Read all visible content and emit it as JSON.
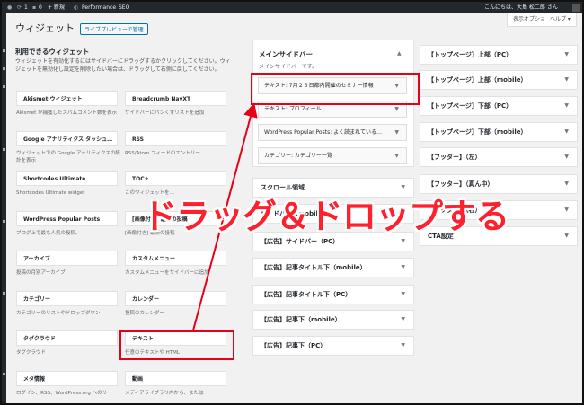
{
  "admin_bar": {
    "updates_count": "1",
    "comments_count": "0",
    "new_label": "+ 新規",
    "performance_label": "Performance",
    "seo_label": "SEO",
    "greeting": "こんにちは、大島 松二郎 さん"
  },
  "header": {
    "title": "ウィジェット",
    "preview_button": "ライブプレビューで管理",
    "screen_options": "表示オプション ▾",
    "help": "ヘルプ ▾"
  },
  "available": {
    "title": "利用できるウィジェット",
    "description": "ウィジェットを有効化するにはサイドバーにドラッグするかクリックしてください。ウィジェットを無効化し設定を削除したい場合は、ドラッグして右側に戻してください。",
    "widgets": [
      {
        "name": "Akismet ウィジェット",
        "desc": "Akismet が捕獲したスパムコメント数を表示"
      },
      {
        "name": "Breadcrumb NavXT",
        "desc": "サイドバーにパンくずリストを追加"
      },
      {
        "name": "Google アナリティクス タッシュ…",
        "desc": "ウィジェットでの Google アナリティクスの統計を表示"
      },
      {
        "name": "RSS",
        "desc": "RSS/Atom フィードのエントリー"
      },
      {
        "name": "Shortcodes Ultimate",
        "desc": "Shortcodes Ultimate widget"
      },
      {
        "name": "TOC+",
        "desc": "このウィジェットを…"
      },
      {
        "name": "WordPress Popular Posts",
        "desc": "ブログ上で最も人気の投稿。"
      },
      {
        "name": "[画像付き] 最新の投稿",
        "desc": "[画像付き] 最新の投稿"
      },
      {
        "name": "アーカイブ",
        "desc": "投稿の月別アーカイブ"
      },
      {
        "name": "カスタムメニュー",
        "desc": "カスタムメニューをサイドバーに追加"
      },
      {
        "name": "カテゴリー",
        "desc": "カテゴリーのリストやドロップダウン"
      },
      {
        "name": "カレンダー",
        "desc": "投稿のカレンダー"
      },
      {
        "name": "タグクラウド",
        "desc": "タグクラウド"
      },
      {
        "name": "テキスト",
        "desc": "任意のテキストや HTML"
      },
      {
        "name": "メタ情報",
        "desc": "ログイン、RSS、WordPress.org へのリ"
      },
      {
        "name": "動画",
        "desc": "メディアライブラリ内から、または"
      }
    ]
  },
  "main_sidebar": {
    "title": "メインサイドバー",
    "subtitle": "メインサイドバーです。",
    "widgets": [
      "テキスト: 7月２３日都内開催のセミナー情報",
      "テキスト: プロフィール",
      "WordPress Popular Posts: よく読まれている…",
      "カテゴリー: カテゴリー一覧"
    ]
  },
  "middle_column": [
    "スクロール領域",
    "サイドバー（mobile）",
    "【広告】サイドバー（PC）",
    "【広告】記事タイトル下（mobile）",
    "【広告】記事タイトル下（PC）",
    "【広告】記事下（mobile）",
    "【広告】記事下（PC）"
  ],
  "right_column": [
    "【トップページ】上部（PC）",
    "【トップページ】上部（mobile）",
    "【トップページ】下部（PC）",
    "【トップページ】下部（mobile）",
    "【フッター】（左）",
    "【フッター】（真ん中）",
    "【フッター】（右）",
    "CTA設定"
  ],
  "annotation": {
    "text": "ドラッグ＆ドロップする",
    "color": "#ff1f2d"
  }
}
